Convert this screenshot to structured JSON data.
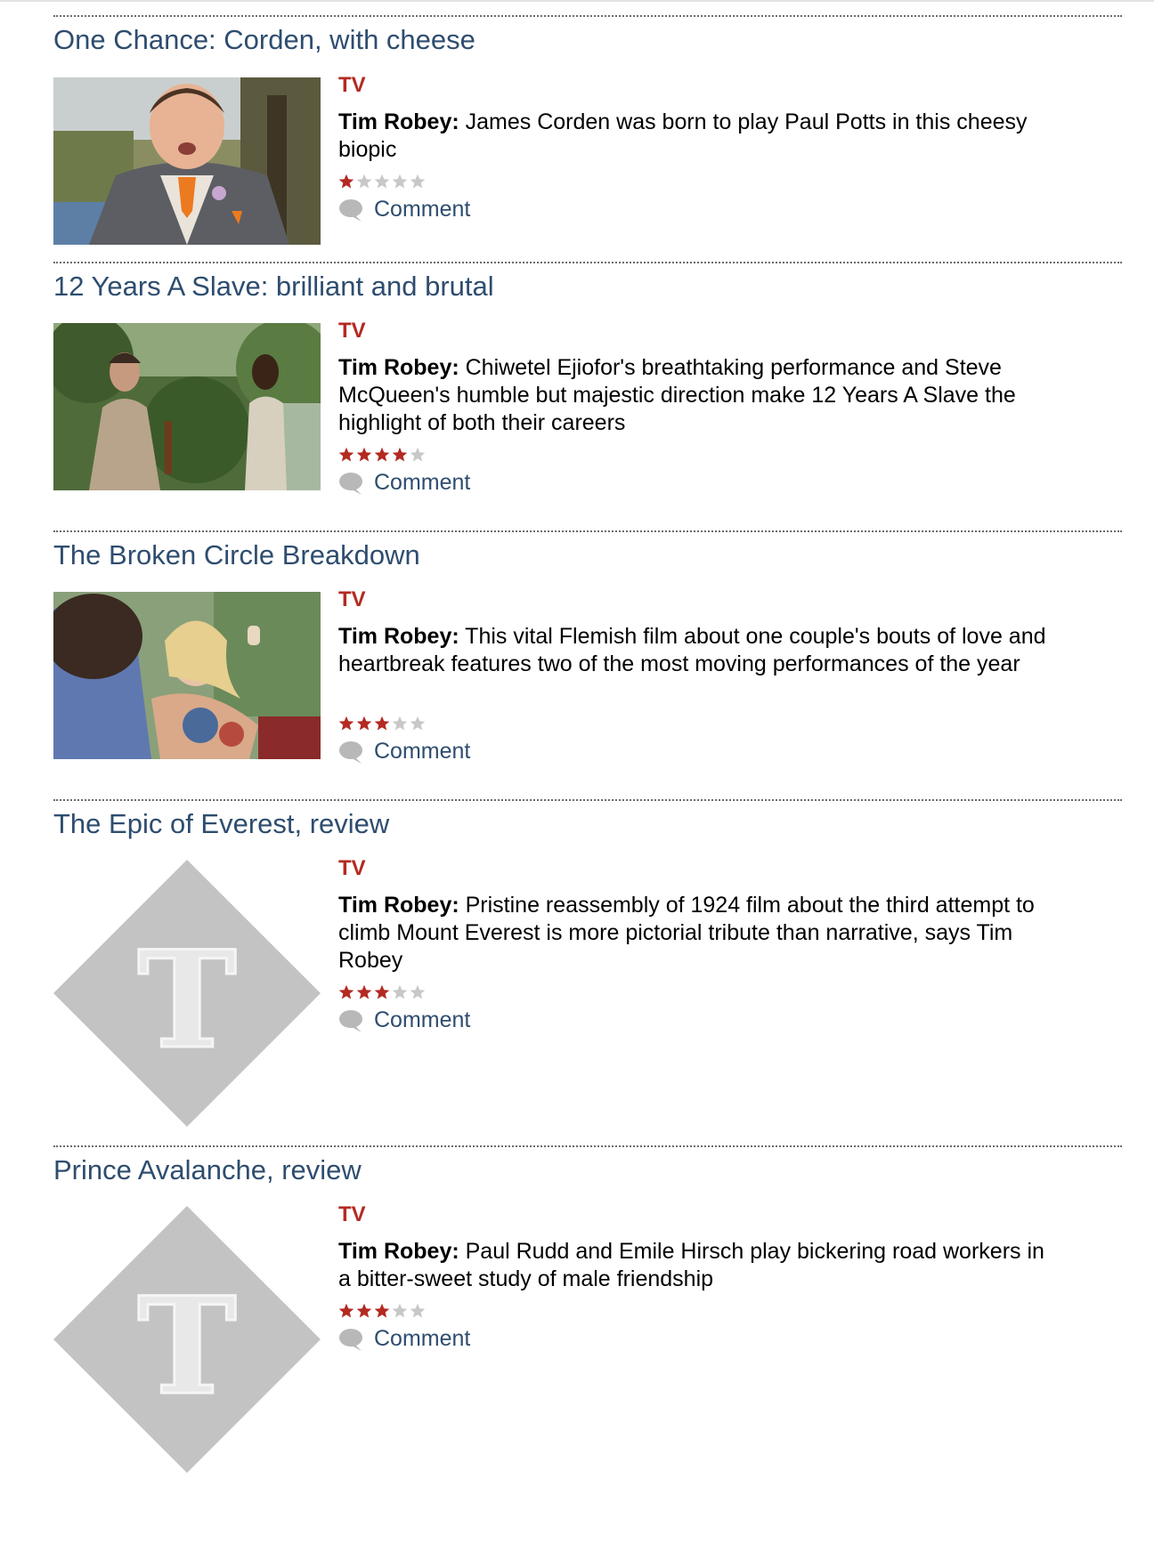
{
  "colors": {
    "accent": "#b32a22",
    "link": "#2e4d6f",
    "star_on": "#b32a22",
    "star_off": "#c8c8c8",
    "divider": "#6b6b6b"
  },
  "articles": [
    {
      "title": "One Chance: Corden, with cheese",
      "category": "TV",
      "author": "Tim Robey:",
      "summary": "James Corden was born to play Paul Potts in this cheesy biopic",
      "rating": 1,
      "rating_max": 5,
      "comment_label": "Comment",
      "image": "photo-man-in-suit-with-orange-tie"
    },
    {
      "title": "12 Years A Slave: brilliant and brutal",
      "category": "TV",
      "author": "Tim Robey:",
      "summary": "Chiwetel Ejiofor's breathtaking performance and Steve McQueen's humble but majestic direction make 12 Years A Slave the highlight of both their careers",
      "rating": 4,
      "rating_max": 5,
      "comment_label": "Comment",
      "image": "photo-two-men-in-garden"
    },
    {
      "title": "The Broken Circle Breakdown",
      "category": "TV",
      "author": "Tim Robey:",
      "summary": "This vital Flemish film about one couple's bouts of love and heartbreak features two of the most moving performances of the year",
      "rating": 3,
      "rating_max": 5,
      "comment_label": "Comment",
      "image": "photo-couple-by-car"
    },
    {
      "title": "The Epic of Everest, review",
      "category": "TV",
      "author": "Tim Robey:",
      "summary": "Pristine reassembly of 1924 film about the third attempt to climb Mount Everest is more pictorial tribute than narrative, says Tim Robey",
      "rating": 3,
      "rating_max": 5,
      "comment_label": "Comment",
      "image": "telegraph-placeholder-logo"
    },
    {
      "title": "Prince Avalanche, review",
      "category": "TV",
      "author": "Tim Robey:",
      "summary": "Paul Rudd and Emile Hirsch play bickering road workers in a bitter-sweet study of male friendship",
      "rating": 3,
      "rating_max": 5,
      "comment_label": "Comment",
      "image": "telegraph-placeholder-logo"
    }
  ]
}
